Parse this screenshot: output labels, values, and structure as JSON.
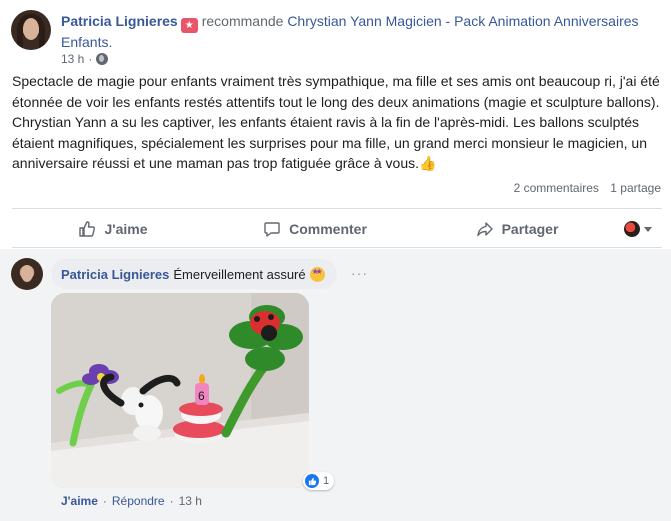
{
  "post": {
    "author": "Patricia Lignieres",
    "verb": "recommande",
    "page": "Chrystian Yann Magicien - Pack Animation Anniversaires Enfants.",
    "time": "13 h",
    "text": "Spectacle de magie pour enfants vraiment très sympathique, ma fille et ses amis ont beaucoup ri, j'ai été étonnée de voir les enfants restés attentifs tout le long des deux animations (magie et sculpture ballons). Chrystian Yann a su les captiver, les enfants étaient ravis à la fin de l'après-midi. Les ballons sculptés étaient magnifiques, spécialement les surprises pour ma fille, un grand merci monsieur le magicien, un anniversaire réussi et une maman pas trop fatiguée grâce à vous.",
    "emoji": "👍",
    "comments_count": "2 commentaires",
    "shares_count": "1 partage"
  },
  "actions": {
    "like": "J'aime",
    "comment": "Commenter",
    "share": "Partager"
  },
  "comment": {
    "author": "Patricia Lignieres",
    "text": "Émerveillement assuré",
    "reaction_count": "1",
    "like": "J'aime",
    "reply": "Répondre",
    "time": "13 h",
    "more": "···"
  }
}
